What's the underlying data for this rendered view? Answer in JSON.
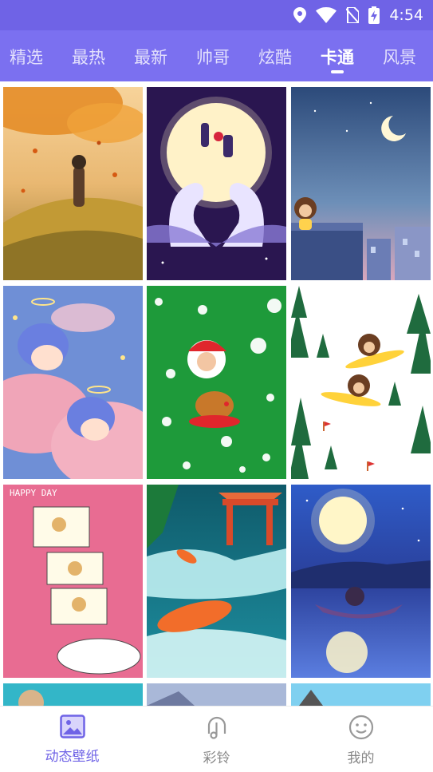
{
  "status_bar": {
    "time": "4:54",
    "icons": [
      "location-icon",
      "wifi-icon",
      "no-sim-icon",
      "battery-charging-icon"
    ]
  },
  "tabs": {
    "items": [
      {
        "label": "精选"
      },
      {
        "label": "最热"
      },
      {
        "label": "最新"
      },
      {
        "label": "帅哥"
      },
      {
        "label": "炫酷"
      },
      {
        "label": "卡通"
      },
      {
        "label": "风景"
      }
    ],
    "active_index": 5
  },
  "wallpapers": [
    {
      "id": "autumn-girl",
      "subject": "girl in autumn field with falling leaves"
    },
    {
      "id": "moon-swans",
      "subject": "couple on moon with swans"
    },
    {
      "id": "night-rooftop",
      "subject": "cartoon character on rooftop under crescent moon"
    },
    {
      "id": "sleeping-angels",
      "subject": "sleeping angels on pink clouds"
    },
    {
      "id": "santa-green",
      "subject": "santa and reindeer on green with snowflakes"
    },
    {
      "id": "snowboarding",
      "subject": "cartoon characters snowboarding among pines"
    },
    {
      "id": "happy-day",
      "subject": "cute stickers on pink",
      "text": "HAPPY DAY"
    },
    {
      "id": "koi-waterfall",
      "subject": "koi fish and waterfall with pavilion"
    },
    {
      "id": "moon-lake",
      "subject": "characters on boat under full moon"
    }
  ],
  "bottom_nav": {
    "items": [
      {
        "label": "动态壁纸",
        "icon": "image-icon"
      },
      {
        "label": "彩铃",
        "icon": "music-note-icon"
      },
      {
        "label": "我的",
        "icon": "smile-face-icon"
      }
    ],
    "active_index": 0
  },
  "colors": {
    "status_bar": "#6f63e6",
    "tab_bar": "#7b70f0",
    "accent": "#6f63e6",
    "inactive": "#888888"
  }
}
